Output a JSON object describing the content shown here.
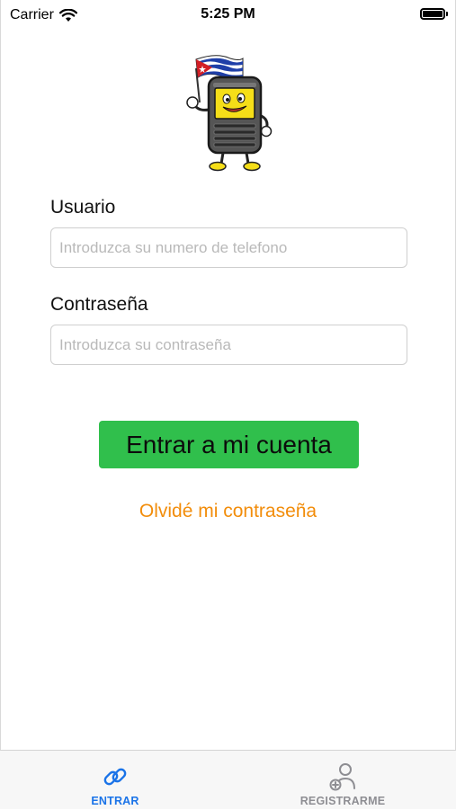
{
  "status_bar": {
    "carrier": "Carrier",
    "time": "5:25 PM",
    "wifi_icon": "wifi-icon",
    "battery_icon": "battery-icon"
  },
  "logo": {
    "icon": "phone-mascot-with-cuban-flag"
  },
  "form": {
    "username_label": "Usuario",
    "username_placeholder": "Introduzca su numero de telefono",
    "username_value": "",
    "password_label": "Contraseña",
    "password_placeholder": "Introduzca su contraseña",
    "password_value": "",
    "login_button": "Entrar a mi cuenta",
    "forgot_link": "Olvidé mi contraseña"
  },
  "tab_bar": {
    "tabs": [
      {
        "label": "ENTRAR",
        "icon": "link-icon",
        "active": true
      },
      {
        "label": "REGISTRARME",
        "icon": "add-user-icon",
        "active": false
      }
    ]
  },
  "colors": {
    "primary_button": "#30bf4c",
    "link": "#f28d0b",
    "tab_active": "#1a73e8",
    "tab_inactive": "#8e8e93"
  }
}
